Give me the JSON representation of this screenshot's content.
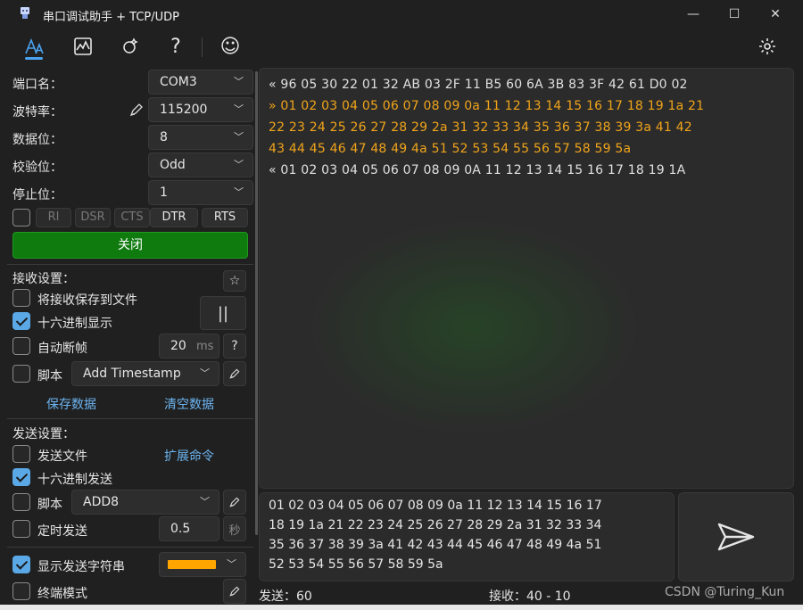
{
  "window": {
    "title": "串口调试助手 + TCP/UDP",
    "minimize": "—",
    "maximize": "☐",
    "close": "✕"
  },
  "toolbar": {
    "icons": [
      "serial-font-icon",
      "chart-icon",
      "magic-icon",
      "help-icon",
      "smiley-icon",
      "gear-icon"
    ],
    "help_glyph": "?",
    "smiley_glyph": "☺"
  },
  "serial": {
    "port_label": "端口名：",
    "port_value": "COM3",
    "baud_label": "波特率：",
    "baud_value": "115200",
    "databits_label": "数据位：",
    "databits_value": "8",
    "parity_label": "校验位：",
    "parity_value": "Odd",
    "stopbits_label": "停止位：",
    "stopbits_value": "1",
    "signals": [
      "RI",
      "DSR",
      "CTS",
      "DTR",
      "RTS"
    ],
    "close_button": "关闭"
  },
  "receive": {
    "section": "接收设置：",
    "save_to_file": "将接收保存到文件",
    "hex_display": "十六进制显示",
    "auto_frame": "自动断帧",
    "auto_frame_value": "20",
    "auto_frame_unit": "ms",
    "help": "?",
    "script": "脚本",
    "script_value": "Add Timestamp",
    "save_data": "保存数据",
    "clear_data": "清空数据",
    "star": "☆",
    "pause": "||"
  },
  "send": {
    "section": "发送设置：",
    "send_file": "发送文件",
    "extend_cmd": "扩展命令",
    "hex_send": "十六进制发送",
    "script": "脚本",
    "script_value": "ADD8",
    "timed_send": "定时发送",
    "timed_value": "0.5",
    "timed_unit": "秒",
    "show_send_string": "显示发送字符串",
    "terminal_mode": "终端模式"
  },
  "recv_lines": [
    {
      "dir": "rx",
      "text": "« 96 05 30 22 01 32 AB 03 2F 11 B5 60 6A 3B 83 3F 42 61 D0 02"
    },
    {
      "dir": "tx",
      "text": "» 01 02 03 04 05 06 07 08 09 0a 11 12 13 14 15 16 17 18 19 1a 21"
    },
    {
      "dir": "tx",
      "text": "22 23 24 25 26 27 28 29 2a 31 32 33 34 35 36 37 38 39 3a 41 42"
    },
    {
      "dir": "tx",
      "text": "43 44 45 46 47 48 49 4a 51 52 53 54 55 56 57 58 59 5a"
    },
    {
      "dir": "rx",
      "text": "« 01 02 03 04 05 06 07 08 09 0A 11 12 13 14 15 16 17 18 19 1A"
    }
  ],
  "send_lines": [
    "01 02 03 04 05 06 07 08 09 0a 11 12 13 14 15 16 17",
    "18 19 1a 21 22 23 24 25 26 27 28 29 2a 31 32 33 34",
    "35 36 37 38 39 3a 41 42 43 44 45 46 47 48 49 4a 51",
    "52 53 54 55 56 57 58 59 5a"
  ],
  "status": {
    "sent": "发送：60",
    "received": "接收：40 - 10",
    "watermark": "CSDN @Turing_Kun"
  },
  "colors": {
    "accent": "#5ba8e6",
    "open_green": "#0f7b0f",
    "tx_orange": "#f0a41a",
    "send_color": "#ffa500"
  }
}
